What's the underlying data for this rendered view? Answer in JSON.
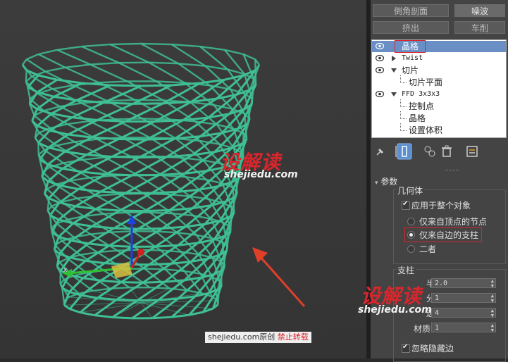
{
  "toolbar": {
    "bevel_profile": "倒角剖面",
    "noise": "噪波",
    "extrude": "挤出",
    "lathe": "车削"
  },
  "modifier_stack": {
    "items": [
      {
        "label": "晶格",
        "level": 0,
        "selected": true
      },
      {
        "label": "Twist",
        "level": 0,
        "mono": true
      },
      {
        "label": "切片",
        "level": 0
      },
      {
        "label": "切片平面",
        "level": 1
      },
      {
        "label": "FFD 3x3x3",
        "level": 0,
        "mono": true
      },
      {
        "label": "控制点",
        "level": 1
      },
      {
        "label": "晶格",
        "level": 1
      },
      {
        "label": "设置体积",
        "level": 1
      }
    ]
  },
  "params": {
    "rollout_title": "参数",
    "geometry_title": "几何体",
    "apply_entire": "应用于整个对象",
    "from_vertices": "仅来自顶点的节点",
    "from_edges": "仅来自边的支柱",
    "both": "二者",
    "struts_title": "支柱",
    "radius_label": "半径:",
    "radius_value": "2.0",
    "segments_label": "分段:",
    "segments_value": "1",
    "sides_label": "边数:",
    "sides_value": "4",
    "material_label": "材质 ID:",
    "material_value": "1",
    "ignore_hidden": "忽略隐藏边"
  },
  "watermark": {
    "logo": "设解读",
    "url": "shejiedu.com",
    "credit_site": "shejiedu.com",
    "credit_orig": "原创",
    "credit_warn": "禁止转载"
  },
  "colors": {
    "mesh": "#3fbf94",
    "accent_red": "#d8262c",
    "selected_row": "#6a8fc4"
  }
}
